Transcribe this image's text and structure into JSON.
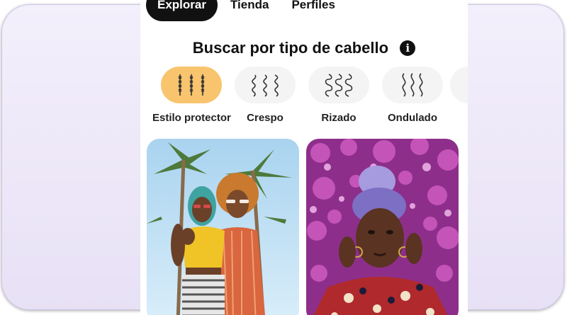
{
  "tabs": [
    {
      "label": "Explorar",
      "active": true
    },
    {
      "label": "Tienda",
      "active": false
    },
    {
      "label": "Perfiles",
      "active": false
    }
  ],
  "section": {
    "title": "Buscar por tipo de cabello",
    "info_icon": "info-icon"
  },
  "hair_types": [
    {
      "label": "Estilo protector",
      "icon": "braids-icon",
      "active": true
    },
    {
      "label": "Crespo",
      "icon": "coily-hair-icon",
      "active": false
    },
    {
      "label": "Rizado",
      "icon": "curly-hair-icon",
      "active": false
    },
    {
      "label": "Ondulado",
      "icon": "wavy-hair-icon",
      "active": false
    }
  ],
  "colors": {
    "active_tab_bg": "#111111",
    "active_hair_pill": "#f9c46e",
    "inactive_hair_pill": "#f4f4f4",
    "backdrop": "#ece6f7"
  }
}
